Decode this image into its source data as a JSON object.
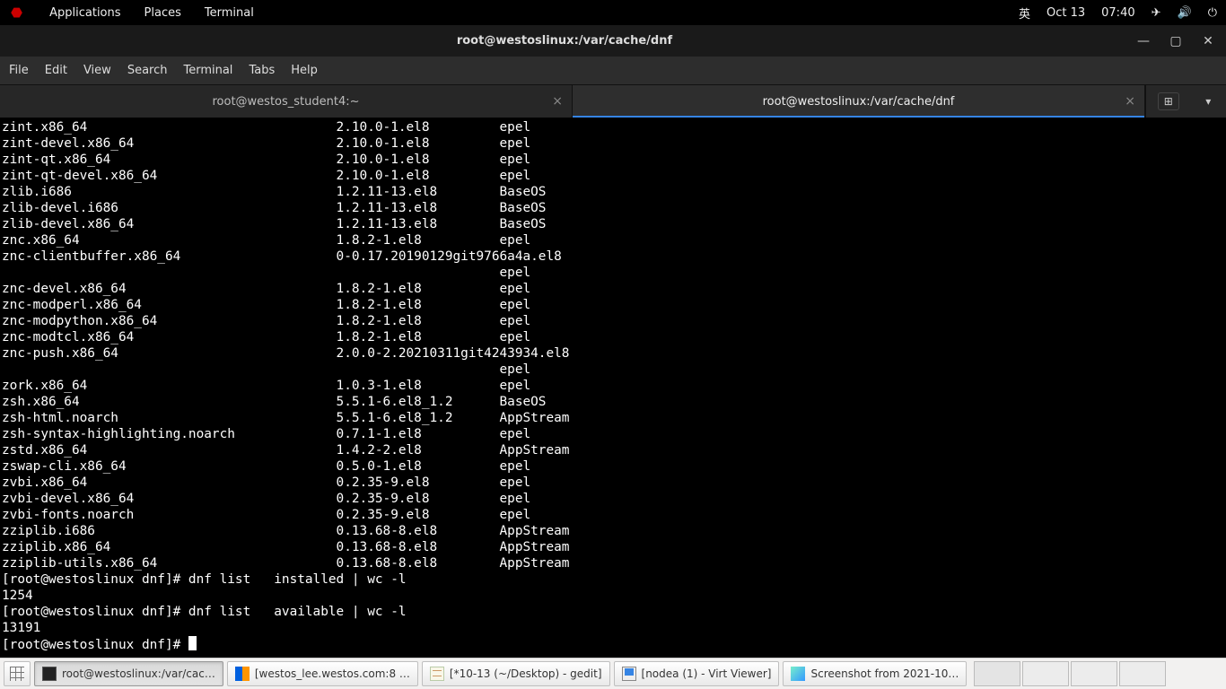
{
  "panel": {
    "applications": "Applications",
    "places": "Places",
    "terminal": "Terminal",
    "ime": "英",
    "date": "Oct 13",
    "time": "07:40"
  },
  "titlebar": {
    "title": "root@westoslinux:/var/cache/dnf"
  },
  "menubar": [
    "File",
    "Edit",
    "View",
    "Search",
    "Terminal",
    "Tabs",
    "Help"
  ],
  "tabs": [
    {
      "label": "root@westos_student4:~",
      "active": false
    },
    {
      "label": "root@westoslinux:/var/cache/dnf",
      "active": true
    }
  ],
  "packages": [
    {
      "name": "zint.x86_64",
      "ver": "2.10.0-1.el8",
      "repo": "epel"
    },
    {
      "name": "zint-devel.x86_64",
      "ver": "2.10.0-1.el8",
      "repo": "epel"
    },
    {
      "name": "zint-qt.x86_64",
      "ver": "2.10.0-1.el8",
      "repo": "epel"
    },
    {
      "name": "zint-qt-devel.x86_64",
      "ver": "2.10.0-1.el8",
      "repo": "epel"
    },
    {
      "name": "zlib.i686",
      "ver": "1.2.11-13.el8",
      "repo": "BaseOS"
    },
    {
      "name": "zlib-devel.i686",
      "ver": "1.2.11-13.el8",
      "repo": "BaseOS"
    },
    {
      "name": "zlib-devel.x86_64",
      "ver": "1.2.11-13.el8",
      "repo": "BaseOS"
    },
    {
      "name": "znc.x86_64",
      "ver": "1.8.2-1.el8",
      "repo": "epel"
    },
    {
      "name": "znc-clientbuffer.x86_64",
      "ver": "0-0.17.20190129git9766a4a.el8",
      "repo": "epel",
      "wrap": true
    },
    {
      "name": "znc-devel.x86_64",
      "ver": "1.8.2-1.el8",
      "repo": "epel"
    },
    {
      "name": "znc-modperl.x86_64",
      "ver": "1.8.2-1.el8",
      "repo": "epel"
    },
    {
      "name": "znc-modpython.x86_64",
      "ver": "1.8.2-1.el8",
      "repo": "epel"
    },
    {
      "name": "znc-modtcl.x86_64",
      "ver": "1.8.2-1.el8",
      "repo": "epel"
    },
    {
      "name": "znc-push.x86_64",
      "ver": "2.0.0-2.20210311git4243934.el8",
      "repo": "epel",
      "wrap": true
    },
    {
      "name": "zork.x86_64",
      "ver": "1.0.3-1.el8",
      "repo": "epel"
    },
    {
      "name": "zsh.x86_64",
      "ver": "5.5.1-6.el8_1.2",
      "repo": "BaseOS"
    },
    {
      "name": "zsh-html.noarch",
      "ver": "5.5.1-6.el8_1.2",
      "repo": "AppStream"
    },
    {
      "name": "zsh-syntax-highlighting.noarch",
      "ver": "0.7.1-1.el8",
      "repo": "epel"
    },
    {
      "name": "zstd.x86_64",
      "ver": "1.4.2-2.el8",
      "repo": "AppStream"
    },
    {
      "name": "zswap-cli.x86_64",
      "ver": "0.5.0-1.el8",
      "repo": "epel"
    },
    {
      "name": "zvbi.x86_64",
      "ver": "0.2.35-9.el8",
      "repo": "epel"
    },
    {
      "name": "zvbi-devel.x86_64",
      "ver": "0.2.35-9.el8",
      "repo": "epel"
    },
    {
      "name": "zvbi-fonts.noarch",
      "ver": "0.2.35-9.el8",
      "repo": "epel"
    },
    {
      "name": "zziplib.i686",
      "ver": "0.13.68-8.el8",
      "repo": "AppStream"
    },
    {
      "name": "zziplib.x86_64",
      "ver": "0.13.68-8.el8",
      "repo": "AppStream"
    },
    {
      "name": "zziplib-utils.x86_64",
      "ver": "0.13.68-8.el8",
      "repo": "AppStream"
    }
  ],
  "cmds": [
    {
      "prompt": "[root@westoslinux dnf]# ",
      "cmd": "dnf list   installed | wc -l",
      "out": "1254"
    },
    {
      "prompt": "[root@westoslinux dnf]# ",
      "cmd": "dnf list   available | wc -l",
      "out": "13191"
    }
  ],
  "finalPrompt": "[root@westoslinux dnf]# ",
  "taskbar": [
    {
      "label": "root@westoslinux:/var/cac…",
      "icon": "term",
      "active": true
    },
    {
      "label": "[westos_lee.westos.com:8 …",
      "icon": "ff"
    },
    {
      "label": "[*10-13 (~/Desktop) - gedit]",
      "icon": "gedit"
    },
    {
      "label": "[nodea (1) - Virt Viewer]",
      "icon": "vm"
    },
    {
      "label": "Screenshot from 2021-10…",
      "icon": "img"
    }
  ],
  "columns": {
    "name": 43,
    "ver": 21
  }
}
